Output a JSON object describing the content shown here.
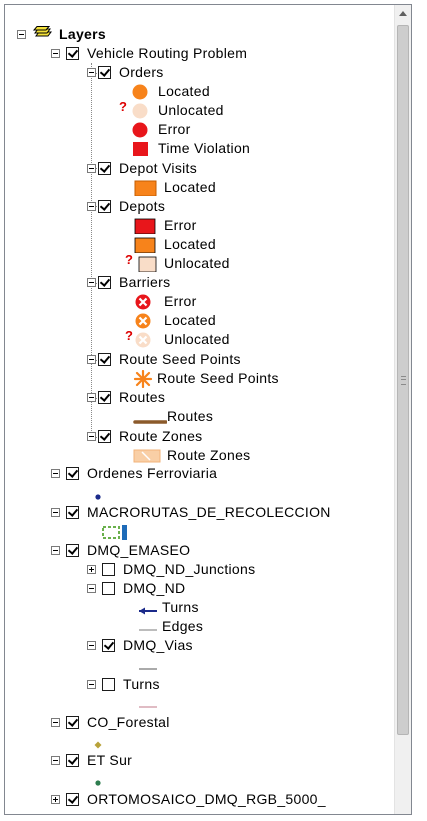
{
  "root": {
    "label": "Layers"
  },
  "vrp": {
    "label": "Vehicle Routing Problem",
    "orders": {
      "label": "Orders",
      "located": "Located",
      "unlocated": "Unlocated",
      "error": "Error",
      "time_violation": "Time Violation"
    },
    "depot_visits": {
      "label": "Depot Visits",
      "located": "Located"
    },
    "depots": {
      "label": "Depots",
      "error": "Error",
      "located": "Located",
      "unlocated": "Unlocated"
    },
    "barriers": {
      "label": "Barriers",
      "error": "Error",
      "located": "Located",
      "unlocated": "Unlocated"
    },
    "route_seed_points": {
      "label": "Route Seed Points",
      "symbol": "Route Seed Points"
    },
    "routes": {
      "label": "Routes",
      "symbol": "Routes"
    },
    "route_zones": {
      "label": "Route Zones",
      "symbol": "Route Zones"
    }
  },
  "layers": {
    "ordenes": {
      "label": "Ordenes Ferroviaria"
    },
    "macrorutas": {
      "label": "MACRORUTAS_DE_RECOLECCION"
    },
    "dmq_emaseo": {
      "label": "DMQ_EMASEO"
    },
    "dmq_nd_junctions": {
      "label": "DMQ_ND_Junctions"
    },
    "dmq_nd": {
      "label": "DMQ_ND",
      "turns": "Turns",
      "edges": "Edges"
    },
    "dmq_vias": {
      "label": "DMQ_Vias"
    },
    "turns": {
      "label": "Turns"
    },
    "co_forestal": {
      "label": "CO_Forestal"
    },
    "et_sur": {
      "label": "ET Sur"
    },
    "ortomosaico": {
      "label": "ORTOMOSAICO_DMQ_RGB_5000_"
    }
  },
  "colors": {
    "orange": "#f7831b",
    "red": "#e8161b",
    "pale": "#f9ddc8",
    "route_brown": "#8b5a2b",
    "edge_gray": "#8a8a8a"
  }
}
